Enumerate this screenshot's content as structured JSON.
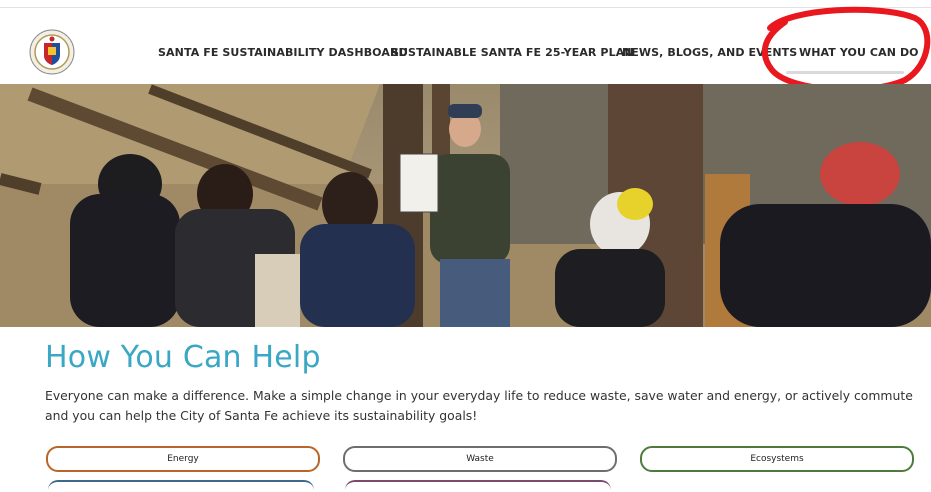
{
  "nav": {
    "items": [
      {
        "label": "SANTA FE SUSTAINABILITY DASHBOARD"
      },
      {
        "label": "SUSTAINABLE SANTA FE 25-YEAR PLAN"
      },
      {
        "label": "NEWS, BLOGS, AND EVENTS"
      },
      {
        "label": "WHAT YOU CAN DO"
      }
    ]
  },
  "main": {
    "title": "How You Can Help",
    "intro": "Everyone can make a difference. Make a simple change in your everyday life to reduce waste, save water and energy, or actively commute and you can help the City of Santa Fe achieve its sustainability goals!",
    "buttons": [
      {
        "label": "Energy",
        "color": "#b8652a"
      },
      {
        "label": "Waste",
        "color": "#6e6e6e"
      },
      {
        "label": "Ecosystems",
        "color": "#4e7a3b"
      }
    ]
  },
  "colors": {
    "accent": "#3aa7c4",
    "annotation": "#e8181e"
  },
  "icons": {
    "logo": "city-of-santa-fe-seal-icon"
  }
}
